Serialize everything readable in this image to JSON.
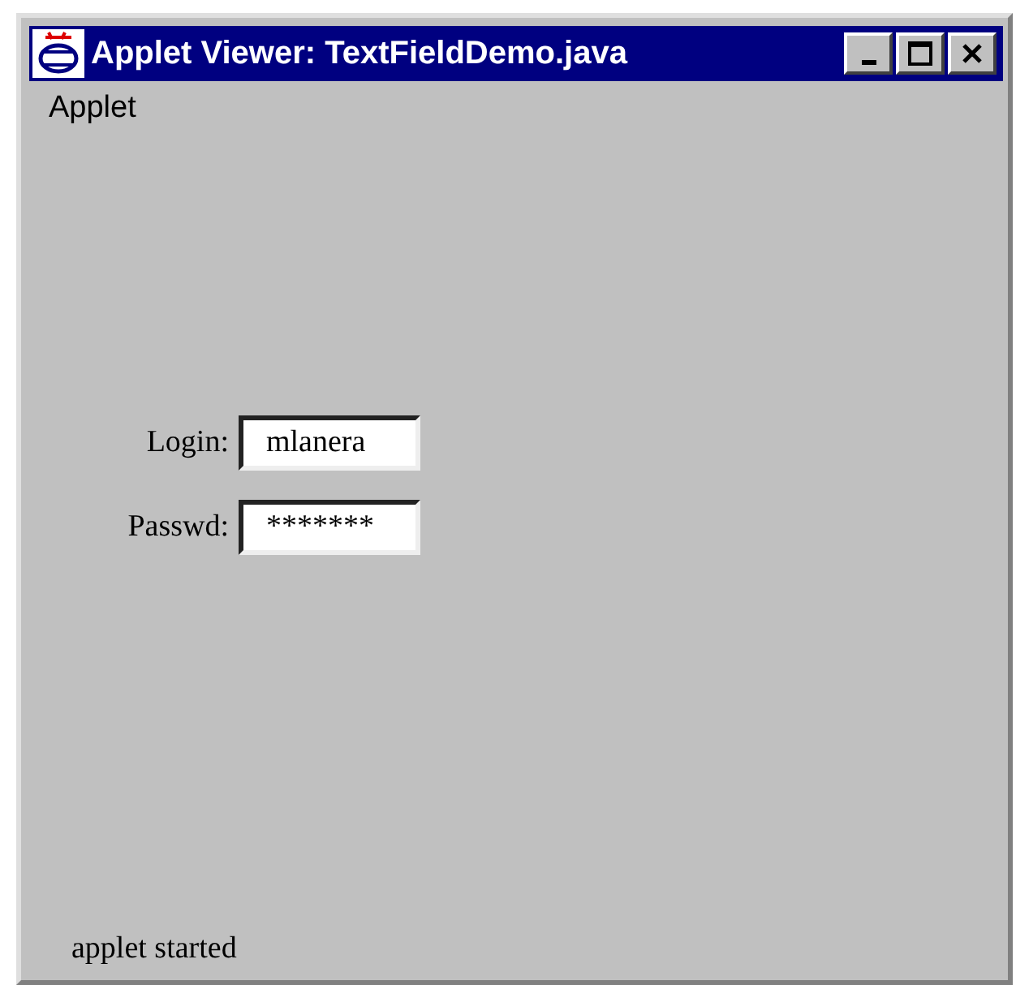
{
  "window": {
    "title": "Applet Viewer: TextFieldDemo.java"
  },
  "menu": [
    "Applet"
  ],
  "fields": [
    {
      "label": "Login:",
      "value": "mlanera"
    },
    {
      "label": "Passwd:",
      "value": "*******"
    }
  ],
  "status_bar": "applet started"
}
